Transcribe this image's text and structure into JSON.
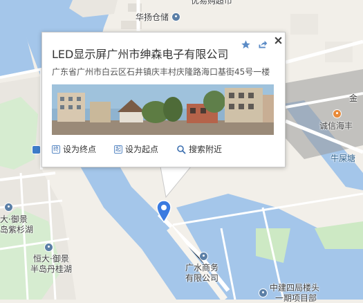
{
  "map": {
    "labels": {
      "huayang": "华扬仓储",
      "youyi": "优易购超市",
      "jin": "金",
      "chengxin": "诚信海丰",
      "niushitang": "牛屎塘",
      "yujing1_line1": "大·御景",
      "yujing1_line2": "岛紫杉湖",
      "yujing2_line1": "恒大·御景",
      "yujing2_line2": "半岛丹桂湖",
      "guangshui_line1": "广水商务",
      "guangshui_line2": "有限公司",
      "zhongjian_line1": "中建四局楼头",
      "zhongjian_line2": "一期项目部"
    }
  },
  "popup": {
    "title": "LED显示屏广州市绅森电子有限公司",
    "address": "广东省广州市白云区石井镇庆丰村庆隆路海口基街45号一楼",
    "actions": {
      "set_end": "设为终点",
      "set_end_icon": "终",
      "set_start": "设为起点",
      "set_start_icon": "起",
      "search_nearby": "搜索附近"
    },
    "icons": {
      "favorite": "star-icon",
      "share": "share-icon",
      "close": "close-icon"
    }
  },
  "colors": {
    "water": "#a4c6ea",
    "green": "#bde6bf",
    "land": "#f2efe9",
    "accent": "#3b7be0"
  }
}
